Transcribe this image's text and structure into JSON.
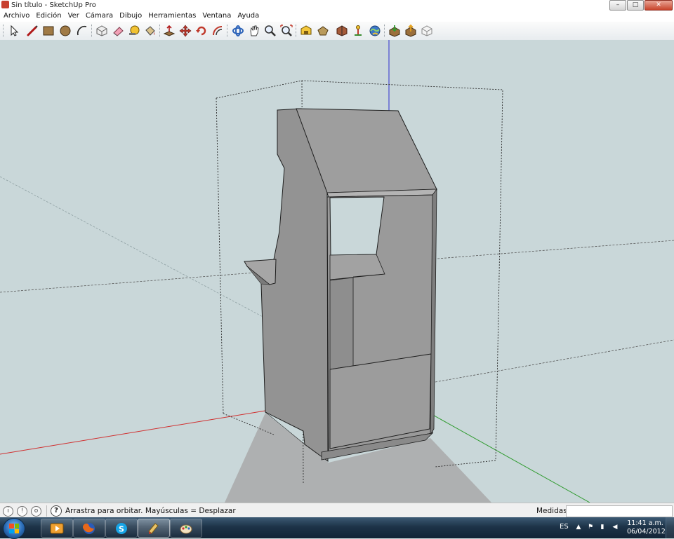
{
  "window": {
    "title": "Sin título - SketchUp Pro"
  },
  "menu": [
    "Archivo",
    "Edición",
    "Ver",
    "Cámara",
    "Dibujo",
    "Herramientas",
    "Ventana",
    "Ayuda"
  ],
  "window_buttons": {
    "minimize": "–",
    "maximize": "□",
    "close": "✕"
  },
  "toolbar": {
    "tools": [
      "select-icon",
      "line-icon",
      "rectangle-icon",
      "circle-icon",
      "arc-icon",
      "make-component-icon",
      "eraser-icon",
      "tape-measure-icon",
      "paint-bucket-icon",
      "push-pull-icon",
      "move-icon",
      "rotate-icon",
      "offset-icon",
      "orbit-icon",
      "pan-icon",
      "zoom-icon",
      "zoom-extents-icon",
      "3d-warehouse-icon",
      "share-model-icon",
      "google-earth-icon",
      "add-location-icon",
      "toggle-terrain-icon",
      "get-models-icon",
      "share-component-icon",
      "extension-icon"
    ]
  },
  "status": {
    "hint": "Arrastra para orbitar. Mayúsculas = Desplazar",
    "help_icon": "?",
    "measure_label": "Medidas",
    "measure_value": ""
  },
  "taskbar": {
    "apps": [
      "media-player-icon",
      "firefox-icon",
      "skype-icon",
      "sketchup-icon",
      "paint-icon"
    ],
    "active": "sketchup-icon"
  },
  "tray": {
    "language": "ES",
    "time": "11:41 a.m.",
    "date": "06/04/2012"
  },
  "colors": {
    "viewport_bg": "#c9d7d9",
    "model_face": "#989898",
    "model_edge": "#1e1e1e",
    "axis_red": "#d03030",
    "axis_green": "#2f9b2f",
    "axis_blue": "#2d2dd0",
    "selection_box": "#333333"
  }
}
